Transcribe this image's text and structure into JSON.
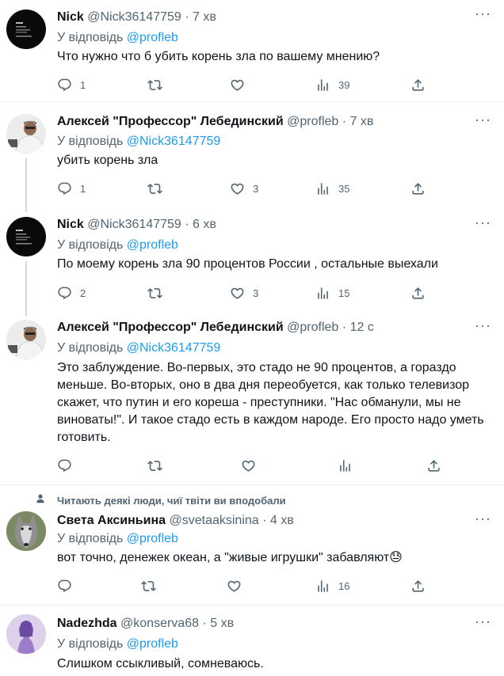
{
  "reply_prefix": "У відповідь",
  "social_context": "Читають деякі люди, чиї твіти ви вподобали",
  "tweets": [
    {
      "name": "Nick",
      "handle": "@Nick36147759",
      "time": "7 хв",
      "reply_to": "@profleb",
      "text": "Что нужно что б убить корень зла по вашему мнению?",
      "replies": "1",
      "retweets": "",
      "likes": "",
      "views": "39"
    },
    {
      "name": "Алексей \"Профессор\" Лебединский",
      "handle": "@profleb",
      "time": "7 хв",
      "reply_to": "@Nick36147759",
      "text": "убить корень зла",
      "replies": "1",
      "retweets": "",
      "likes": "3",
      "views": "35"
    },
    {
      "name": "Nick",
      "handle": "@Nick36147759",
      "time": "6 хв",
      "reply_to": "@profleb",
      "text": "По моему корень зла 90 процентов России , остальные выехали",
      "replies": "2",
      "retweets": "",
      "likes": "3",
      "views": "15"
    },
    {
      "name": "Алексей \"Профессор\" Лебединский",
      "handle": "@profleb",
      "time": "12 с",
      "reply_to": "@Nick36147759",
      "text": "Это заблуждение. Во-первых, это стадо не 90 процентов, а гораздо меньше. Во-вторых, оно в два дня переобуется, как только телевизор скажет, что путин и его кореша - преступники. \"Нас обманули, мы не виноваты!\". И такое стадо есть в каждом народе. Его просто надо уметь готовить.",
      "replies": "",
      "retweets": "",
      "likes": "",
      "views": ""
    },
    {
      "name": "Света Аксиньина",
      "handle": "@svetaaksinina",
      "time": "4 хв",
      "reply_to": "@profleb",
      "text": "вот точно, денежек океан, а \"живые игрушки\" забавляют😓",
      "replies": "",
      "retweets": "",
      "likes": "",
      "views": "16"
    },
    {
      "name": "Nadezhda",
      "handle": "@konserva68",
      "time": "5 хв",
      "reply_to": "@profleb",
      "text": "Слишком ссыкливый, сомневаюсь.",
      "replies": "",
      "retweets": "",
      "likes": "",
      "views": ""
    }
  ],
  "icons": {
    "reply": "reply-icon",
    "retweet": "retweet-icon",
    "like": "heart-icon",
    "views": "views-icon",
    "share": "share-icon",
    "more": "more-icon",
    "person": "person-icon"
  },
  "colors": {
    "text": "#0f1419",
    "secondary": "#536471",
    "link": "#1d9bf0",
    "divider": "#eff3f4",
    "thread_line": "#cfd9de"
  }
}
